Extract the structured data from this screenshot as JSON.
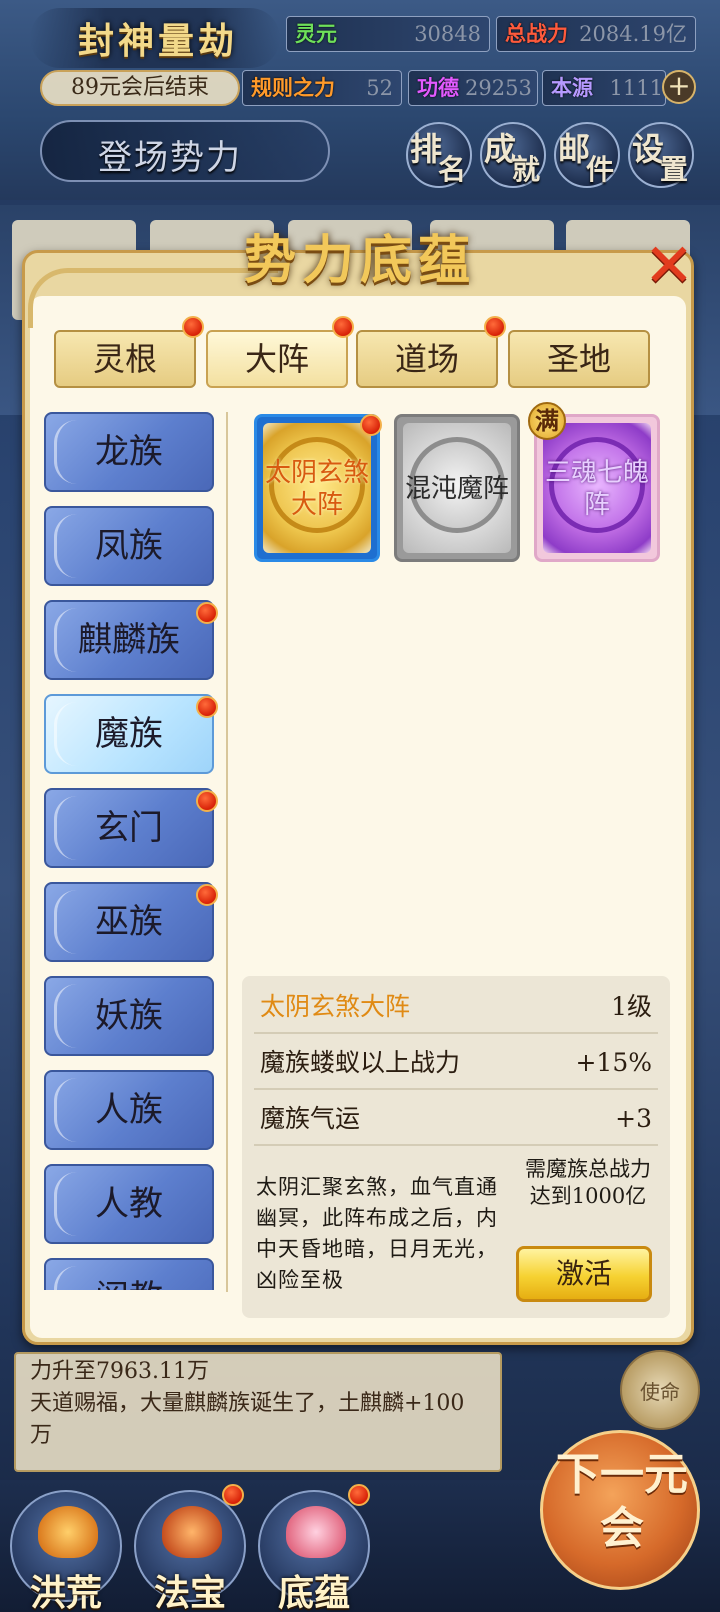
{
  "hud": {
    "game_title": "封神量劫",
    "countdown": "89元会后结束",
    "stats": [
      {
        "label": "灵元",
        "value": "30848",
        "color": "#6ee05a"
      },
      {
        "label": "总战力",
        "value": "2084.19亿",
        "color": "#ff5a3c"
      },
      {
        "label": "规则之力",
        "value": "52",
        "color": "#ff9a2a"
      },
      {
        "label": "功德",
        "value": "29253",
        "color": "#e25aff"
      },
      {
        "label": "本源",
        "value": "1111",
        "color": "#b69aff"
      }
    ],
    "plus_icon": "+",
    "power_entry": "登场势力",
    "top_buttons": [
      {
        "big": "排",
        "small": "名"
      },
      {
        "big": "成",
        "small": "就"
      },
      {
        "big": "邮",
        "small": "件"
      },
      {
        "big": "设",
        "small": "置"
      }
    ]
  },
  "panel": {
    "title": "势力底蕴",
    "close_icon": "✕",
    "tabs": [
      {
        "label": "灵根",
        "badge": true
      },
      {
        "label": "大阵",
        "badge": true,
        "active": true
      },
      {
        "label": "道场",
        "badge": true
      },
      {
        "label": "圣地",
        "badge": false
      }
    ],
    "races": [
      {
        "label": "龙族",
        "badge": false
      },
      {
        "label": "凤族",
        "badge": false
      },
      {
        "label": "麒麟族",
        "badge": true
      },
      {
        "label": "魔族",
        "badge": true,
        "active": true
      },
      {
        "label": "玄门",
        "badge": true
      },
      {
        "label": "巫族",
        "badge": true
      },
      {
        "label": "妖族",
        "badge": false
      },
      {
        "label": "人族",
        "badge": false
      },
      {
        "label": "人教",
        "badge": false
      },
      {
        "label": "阐教",
        "badge": false
      }
    ],
    "formations": [
      {
        "name": "太阴玄煞大阵",
        "style": "gold",
        "badge": true
      },
      {
        "name": "混沌魔阵",
        "style": "grey",
        "badge": false
      },
      {
        "name": "三魂七魄阵",
        "style": "purple",
        "badge": false,
        "full": "满"
      }
    ],
    "detail": {
      "name": "太阴玄煞大阵",
      "level": "1级",
      "effects": [
        {
          "label": "魔族蝼蚁以上战力",
          "value": "+15%"
        },
        {
          "label": "魔族气运",
          "value": "+3"
        }
      ],
      "description": "太阴汇聚玄煞，血气直通幽冥，此阵布成之后，内中天昏地暗，日月无光，凶险至极",
      "requirement": "需魔族总战力达到1000亿",
      "activate_label": "激活"
    }
  },
  "log": {
    "line1": "力升至7963.11万",
    "line2": "天道赐福，大量麒麟族诞生了，土麒麟+100万"
  },
  "side_deco_label": "使命",
  "bottom_nav": [
    {
      "label": "洪荒",
      "icon": "lotus-icon",
      "badge": false
    },
    {
      "label": "法宝",
      "icon": "treasure-icon",
      "badge": true
    },
    {
      "label": "底蕴",
      "icon": "flame-lotus-icon",
      "badge": true
    }
  ],
  "next_button": "下一元会"
}
